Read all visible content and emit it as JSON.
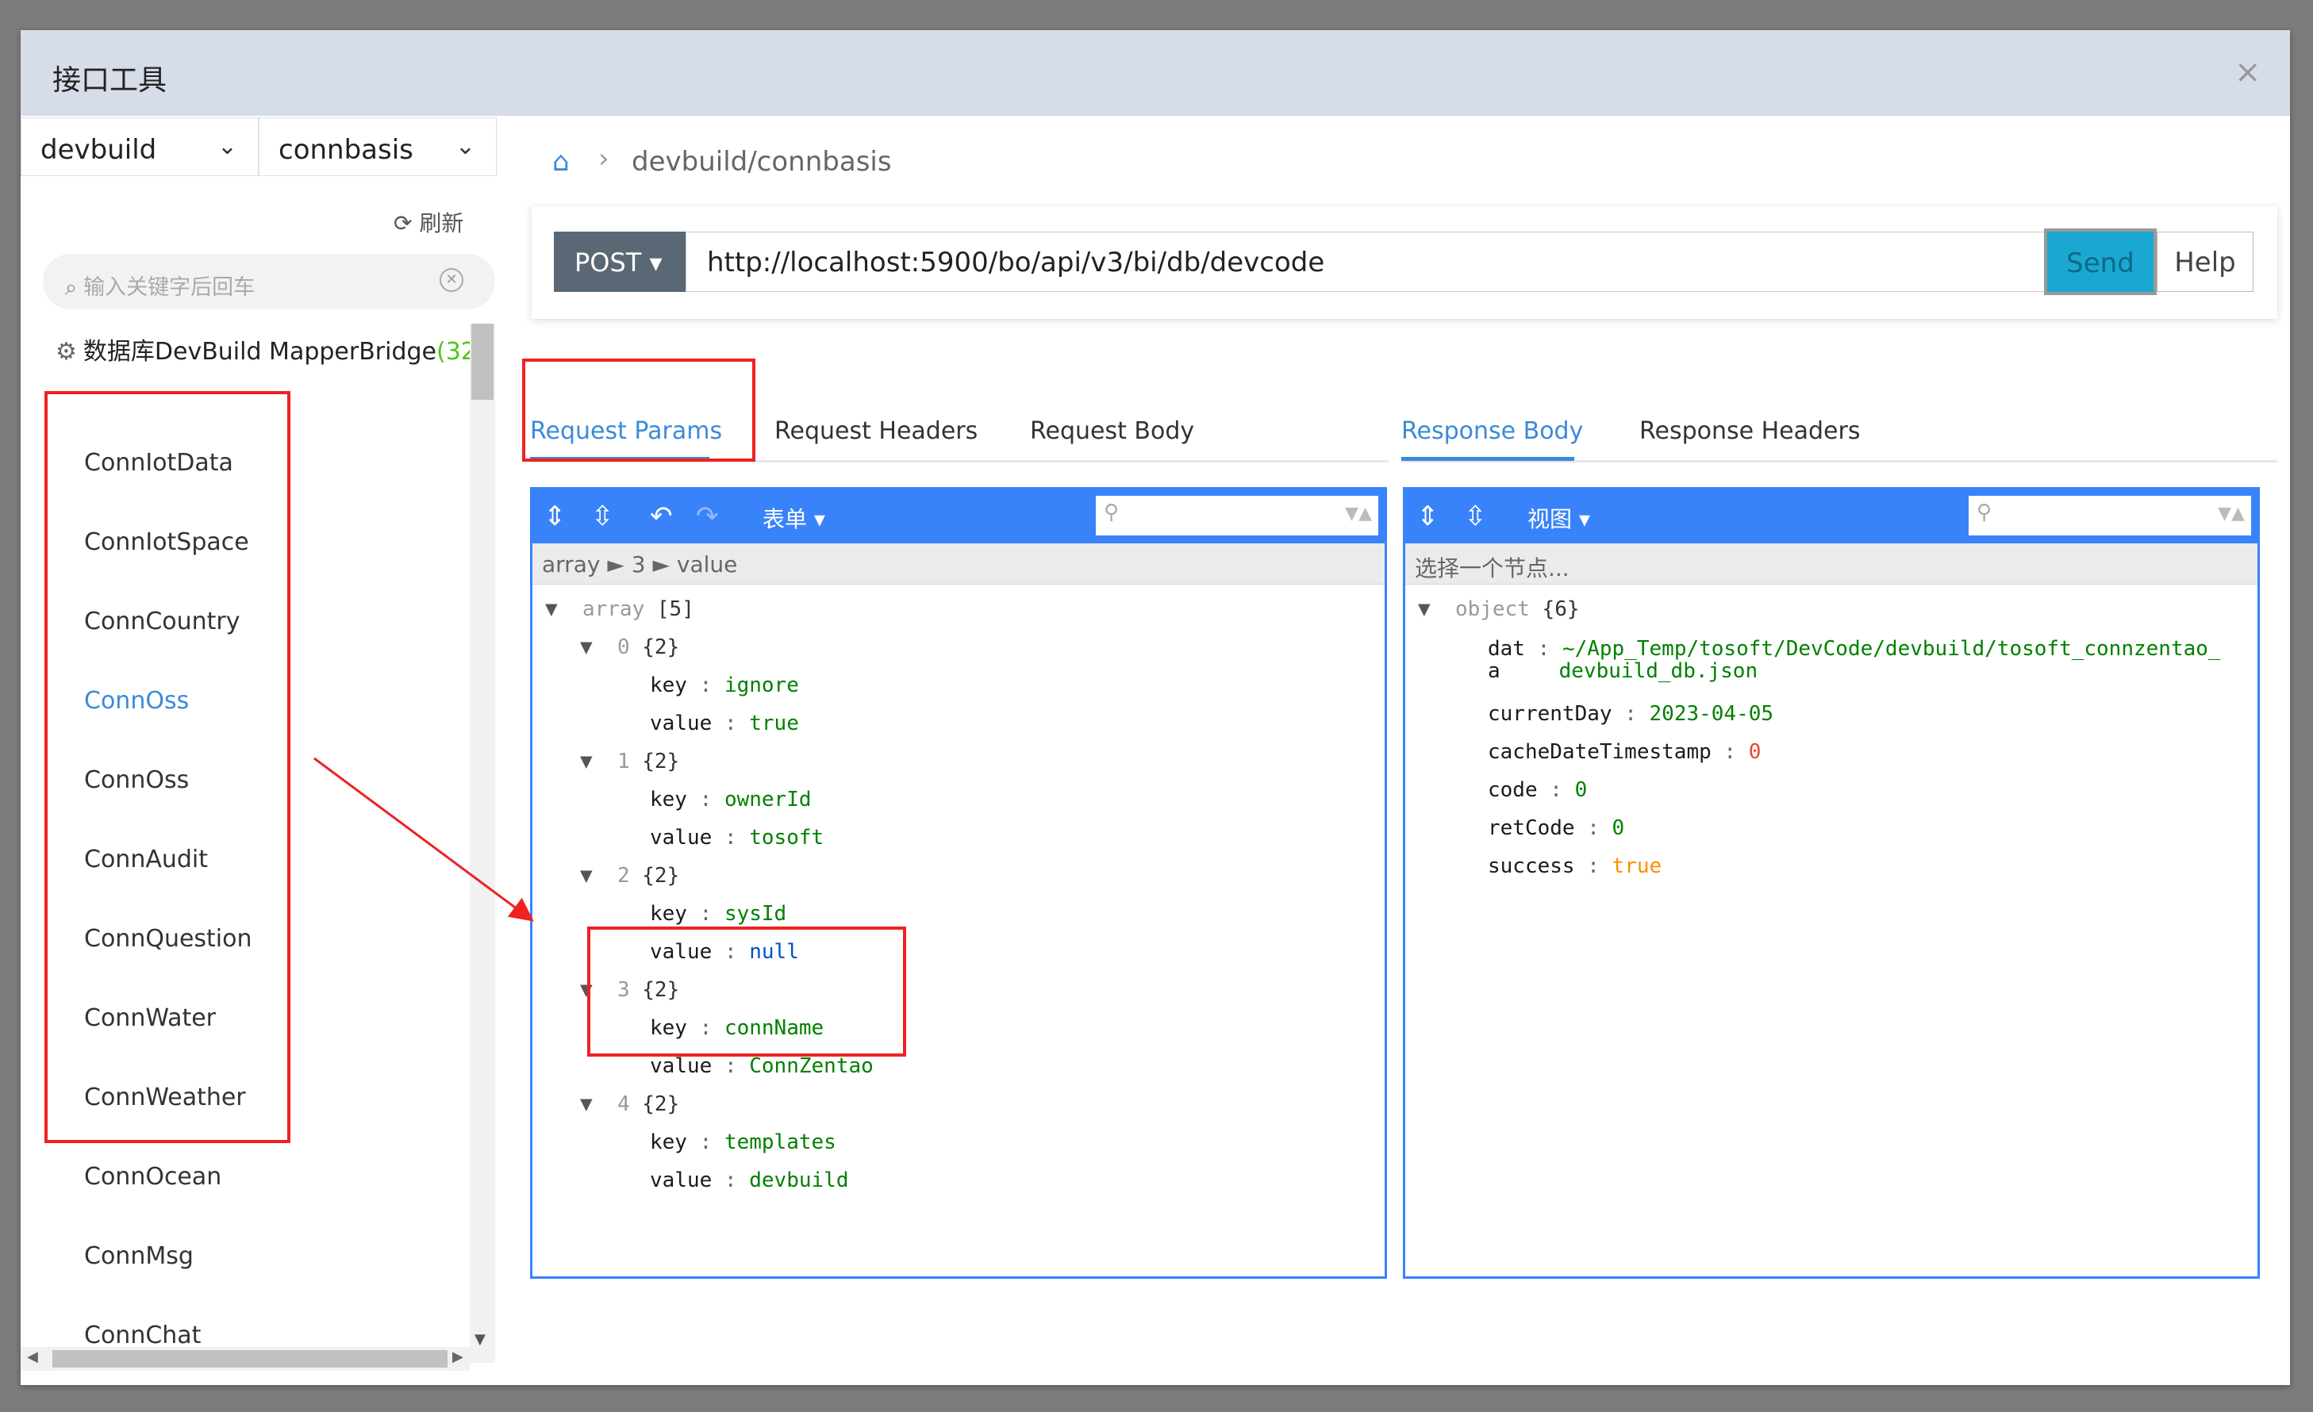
{
  "dialog": {
    "title": "接口工具",
    "close_glyph": "×"
  },
  "left": {
    "db_select": "devbuild",
    "table_select": "connbasis",
    "refresh_label": "刷新",
    "search_placeholder": "输入关键字后回车",
    "db_title": "数据库DevBuild MapperBridge",
    "db_count": "(32",
    "items": [
      "ConnIotData",
      "ConnIotSpace",
      "ConnCountry",
      "ConnOss",
      "ConnOss",
      "ConnAudit",
      "ConnQuestion",
      "ConnWater",
      "ConnWeather",
      "ConnOcean",
      "ConnMsg",
      "ConnChat"
    ],
    "active_index": 3
  },
  "breadcrumb": {
    "path": "devbuild/connbasis"
  },
  "request": {
    "method": "POST",
    "url": "http://localhost:5900/bo/api/v3/bi/db/devcode",
    "send_label": "Send",
    "help_label": "Help"
  },
  "tabs_left": [
    "Request Params",
    "Request Headers",
    "Request Body"
  ],
  "tabs_right": [
    "Response Body",
    "Response Headers"
  ],
  "params_editor": {
    "mode_label": "表单",
    "nav_path": "array ► 3 ► value",
    "root_label": "array",
    "root_count": "[5]",
    "entries": [
      {
        "idx": "0",
        "count": "{2}",
        "key": "ignore",
        "value": "true",
        "value_type": "string"
      },
      {
        "idx": "1",
        "count": "{2}",
        "key": "ownerId",
        "value": "tosoft",
        "value_type": "string"
      },
      {
        "idx": "2",
        "count": "{2}",
        "key": "sysId",
        "value": "null",
        "value_type": "null"
      },
      {
        "idx": "3",
        "count": "{2}",
        "key": "connName",
        "value": "ConnZentao",
        "value_type": "string"
      },
      {
        "idx": "4",
        "count": "{2}",
        "key": "templates",
        "value": "devbuild",
        "value_type": "string"
      }
    ],
    "key_label": "key",
    "value_label": "value"
  },
  "response_editor": {
    "mode_label": "视图",
    "nav_placeholder": "选择一个节点...",
    "root_label": "object",
    "root_count": "{6}",
    "dat_key_line1": "dat",
    "dat_key_line2": "a",
    "dat_value_line1": "~/App_Temp/tosoft/DevCode/devbuild/tosoft_connzentao_",
    "dat_value_line2": "devbuild_db.json",
    "fields": [
      {
        "key": "currentDay",
        "value": "2023-04-05",
        "color": "#008000"
      },
      {
        "key": "cacheDateTimestamp",
        "value": "0",
        "color": "#ee422e"
      },
      {
        "key": "code",
        "value": "0",
        "color": "#008000"
      },
      {
        "key": "retCode",
        "value": "0",
        "color": "#008000"
      },
      {
        "key": "success",
        "value": "true",
        "color": "#ff8c00"
      }
    ]
  },
  "colors": {
    "accent": "#3b8ad9",
    "editor_blue": "#3883fa",
    "send": "#1aa8d2",
    "annotation": "#ee2222"
  }
}
